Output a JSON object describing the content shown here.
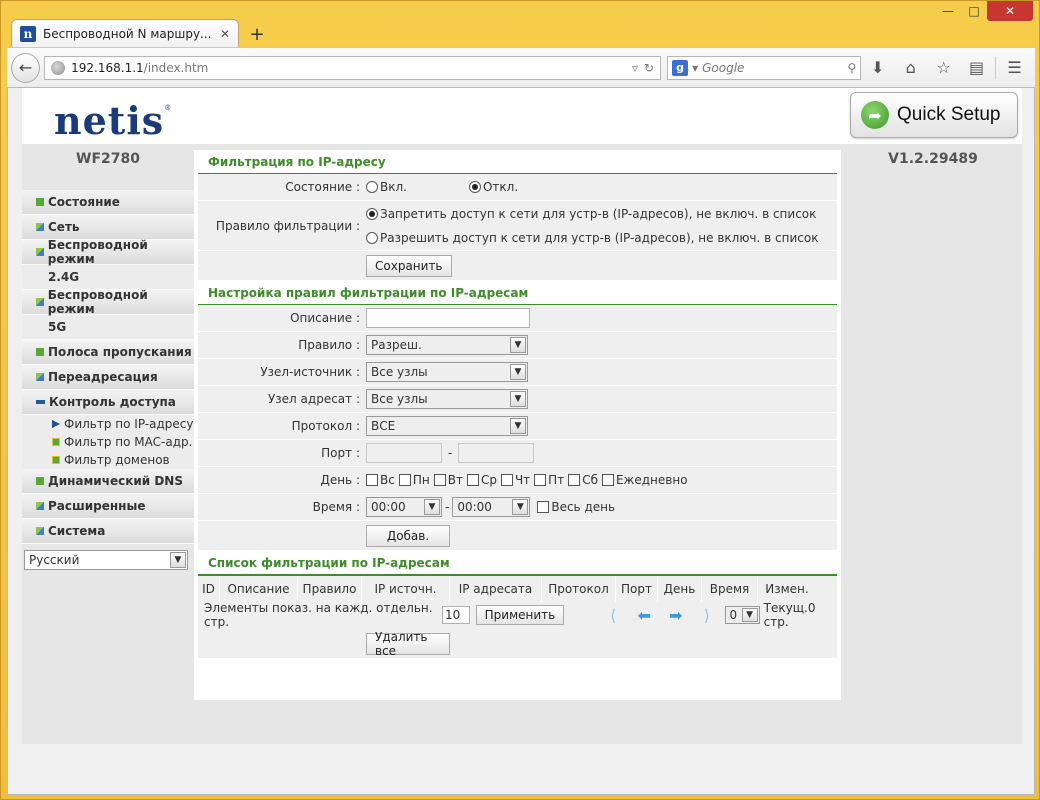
{
  "browser": {
    "tab_title": "Беспроводной N маршру...",
    "tab_favicon": "n",
    "url_host": "192.168.1.1",
    "url_path": "/index.htm",
    "search_placeholder": "Google"
  },
  "header": {
    "logo": "netis",
    "quick_setup_label": "Quick Setup"
  },
  "sidebar": {
    "model": "WF2780",
    "version": "V1.2.29489",
    "items": [
      {
        "label": "Состояние"
      },
      {
        "label": "Сеть"
      },
      {
        "label": "Беспроводной режим"
      },
      {
        "label": "2.4G"
      },
      {
        "label": "Беспроводной режим"
      },
      {
        "label": "5G"
      },
      {
        "label": "Полоса пропускания"
      },
      {
        "label": "Переадресация"
      },
      {
        "label": "Контроль доступа"
      }
    ],
    "subitems": [
      {
        "label": "Фильтр по IP-адресу"
      },
      {
        "label": "Фильтр по MAC-адр."
      },
      {
        "label": "Фильтр доменов"
      }
    ],
    "items_after": [
      {
        "label": "Динамический DNS"
      },
      {
        "label": "Расширенные"
      },
      {
        "label": "Система"
      }
    ],
    "language": "Русский"
  },
  "filter": {
    "title": "Фильтрация по IP-адресу",
    "status_label": "Состояние :",
    "status_on": "Вкл.",
    "status_off": "Откл.",
    "rule_label": "Правило фильтрации :",
    "rule_deny": "Запретить доступ к сети для устр-в (IP-адресов), не включ. в список",
    "rule_allow": "Разрешить доступ к сети для устр-в (IP-адресов), не включ. в список",
    "save_button": "Сохранить"
  },
  "rules": {
    "title": "Настройка правил фильтрации по IP-адресам",
    "description_label": "Описание :",
    "rule_label": "Правило :",
    "rule_value": "Разреш.",
    "source_label": "Узел-источник :",
    "source_value": "Все узлы",
    "dest_label": "Узел адресат :",
    "dest_value": "Все узлы",
    "protocol_label": "Протокол :",
    "protocol_value": "ВСЕ",
    "port_label": "Порт :",
    "port_sep": "-",
    "day_label": "День :",
    "days": [
      "Вс",
      "Пн",
      "Вт",
      "Ср",
      "Чт",
      "Пт",
      "Сб",
      "Ежедневно"
    ],
    "time_label": "Время :",
    "time_from": "00:00",
    "time_sep": "-",
    "time_to": "00:00",
    "all_day": "Весь день",
    "add_button": "Добав."
  },
  "list": {
    "title": "Список фильтрации по IP-адресам",
    "columns": [
      "ID",
      "Описание",
      "Правило",
      "IP источн.",
      "IP адресата",
      "Протокол",
      "Порт",
      "День",
      "Время",
      "Измен."
    ],
    "per_page_label": "Элементы показ. на кажд. отдельн. стр.",
    "per_page_value": "10",
    "apply_button": "Применить",
    "page_value": "0",
    "current_page": "Текущ.0 стр.",
    "delete_all_button": "Удалить все"
  },
  "colors": {
    "section_title": "#3f8c2a",
    "brand_blue": "#1a3a7a",
    "window_frame": "#f4c542"
  }
}
